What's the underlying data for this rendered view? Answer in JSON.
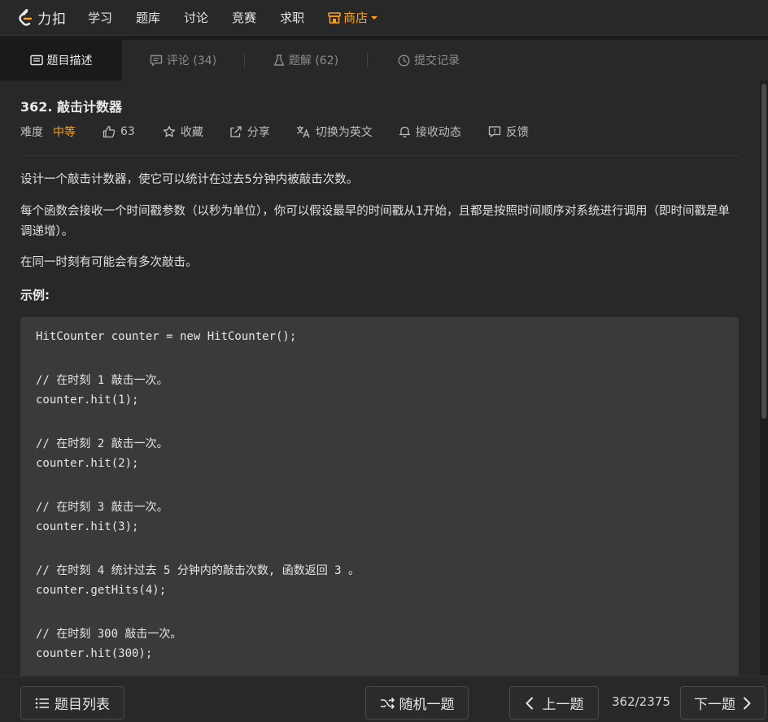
{
  "brand": {
    "logo_text": "力扣",
    "accent": "#ffa116"
  },
  "nav": {
    "items": [
      "学习",
      "题库",
      "讨论",
      "竞赛",
      "求职"
    ],
    "store_label": "商店"
  },
  "tabs": [
    {
      "label": "题目描述",
      "icon": "description-icon"
    },
    {
      "label": "评论 (34)",
      "icon": "comment-icon"
    },
    {
      "label": "题解 (62)",
      "icon": "flask-icon"
    },
    {
      "label": "提交记录",
      "icon": "clock-icon"
    }
  ],
  "problem": {
    "title": "362. 敲击计数器",
    "difficulty_label": "难度",
    "difficulty_value": "中等",
    "likes": "63",
    "favorite_label": "收藏",
    "share_label": "分享",
    "translate_label": "切换为英文",
    "subscribe_label": "接收动态",
    "feedback_label": "反馈",
    "paragraphs": [
      "设计一个敲击计数器，使它可以统计在过去5分钟内被敲击次数。",
      "每个函数会接收一个时间戳参数（以秒为单位），你可以假设最早的时间戳从1开始，且都是按照时间顺序对系统进行调用（即时间戳是单调递增）。",
      "在同一时刻有可能会有多次敲击。"
    ],
    "example_label": "示例:",
    "code_lines": [
      "HitCounter counter = new HitCounter();",
      "// 在时刻 1 敲击一次。",
      "counter.hit(1);",
      "// 在时刻 2 敲击一次。",
      "counter.hit(2);",
      "// 在时刻 3 敲击一次。",
      "counter.hit(3);",
      "// 在时刻 4 统计过去 5 分钟内的敲击次数, 函数返回 3 。",
      "counter.getHits(4);",
      "// 在时刻 300 敲击一次。",
      "counter.hit(300);"
    ]
  },
  "bottom": {
    "list_label": "题目列表",
    "random_label": "随机一题",
    "prev_label": "上一题",
    "page": "362/2375",
    "next_label": "下一题"
  }
}
